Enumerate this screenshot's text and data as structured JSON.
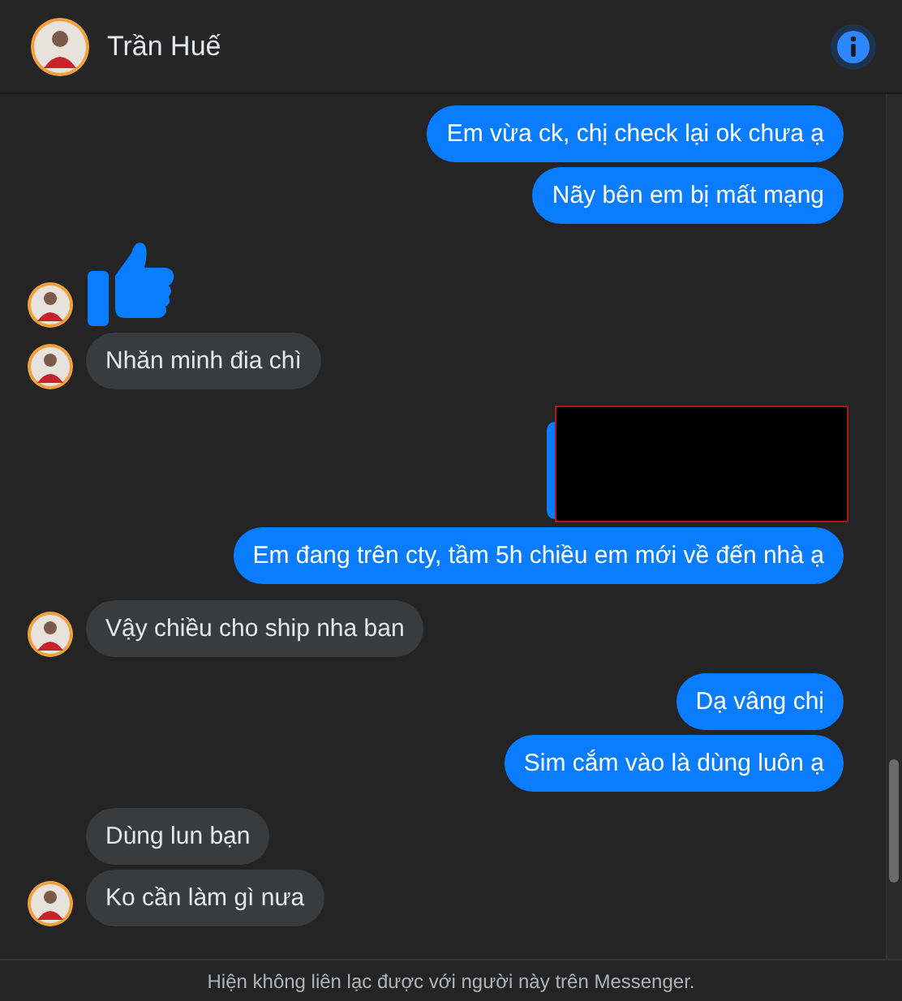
{
  "header": {
    "title": "Trần Huế"
  },
  "messages": [
    {
      "outgoing": true,
      "kind": "text",
      "text": "Em vừa ck, chị check lại ok chưa ạ"
    },
    {
      "outgoing": true,
      "kind": "text",
      "text": "Nãy bên em bị mất mạng"
    },
    {
      "outgoing": false,
      "kind": "like",
      "show_avatar": true
    },
    {
      "outgoing": false,
      "kind": "text",
      "text": "Nhăn minh đia chì",
      "show_avatar": true
    },
    {
      "outgoing": true,
      "kind": "redacted"
    },
    {
      "outgoing": true,
      "kind": "text",
      "text": "Em đang trên cty, tầm 5h chiều em mới về đến nhà ạ"
    },
    {
      "outgoing": false,
      "kind": "text",
      "text": "Vậy chiều cho ship nha ban",
      "show_avatar": true
    },
    {
      "outgoing": true,
      "kind": "text",
      "text": "Dạ vâng chị"
    },
    {
      "outgoing": true,
      "kind": "text",
      "text": "Sim cắm vào là dùng luôn ạ"
    },
    {
      "outgoing": false,
      "kind": "text",
      "text": "Dùng lun bạn",
      "show_avatar": false
    },
    {
      "outgoing": false,
      "kind": "text",
      "text": "Ko cần làm gì nưa",
      "show_avatar": true
    }
  ],
  "footer": {
    "notice": "Hiện không liên lạc được với người này trên Messenger."
  }
}
